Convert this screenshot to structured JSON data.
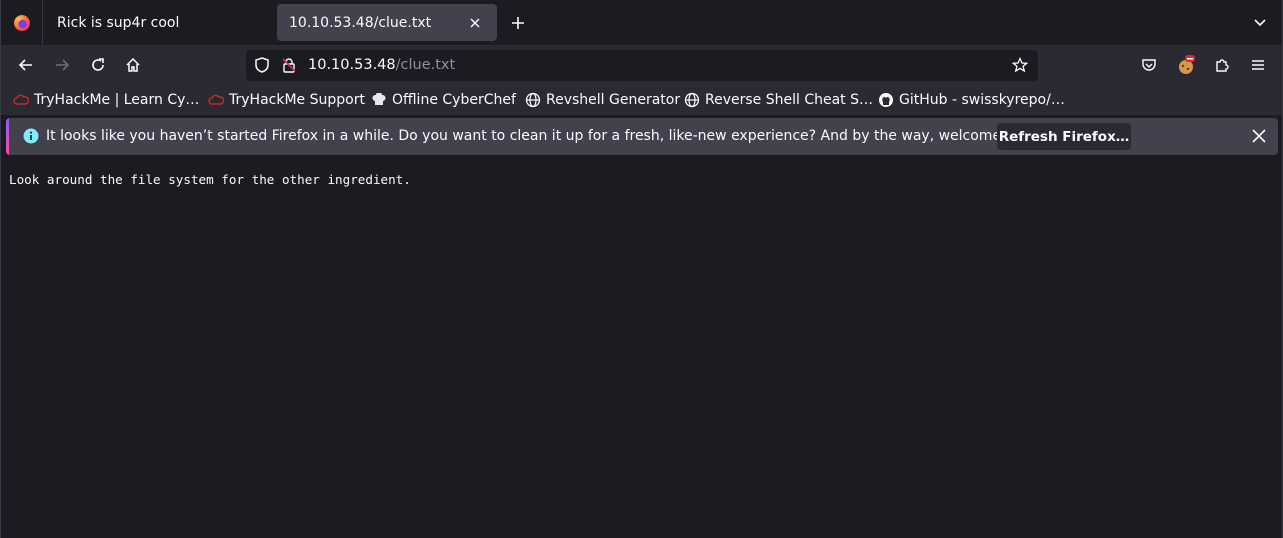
{
  "tabs": [
    {
      "title": "Rick is sup4r cool",
      "active": false
    },
    {
      "title": "10.10.53.48/clue.txt",
      "active": true
    }
  ],
  "urlbar": {
    "host": "10.10.53.48",
    "path": "/clue.txt"
  },
  "bookmarks": [
    {
      "label": "TryHackMe | Learn Cy…",
      "icon": "tryhackme-icon"
    },
    {
      "label": "TryHackMe Support",
      "icon": "tryhackme-icon"
    },
    {
      "label": "Offline CyberChef",
      "icon": "chef-hat-icon"
    },
    {
      "label": "Revshell Generator",
      "icon": "globe-icon"
    },
    {
      "label": "Reverse Shell Cheat S…",
      "icon": "globe-icon"
    },
    {
      "label": "GitHub - swisskyrepo/…",
      "icon": "github-icon"
    }
  ],
  "notification": {
    "message": "It looks like you haven’t started Firefox in a while. Do you want to clean it up for a fresh, like-new experience? And by the way, welcome back!",
    "button": "Refresh Firefox…"
  },
  "page": {
    "text": "Look around the file system for the other ingredient."
  },
  "colors": {
    "accent": "#9059ff",
    "background": "#1c1b22",
    "toolbar": "#2b2a33",
    "tryhackme": "#c22a26"
  }
}
